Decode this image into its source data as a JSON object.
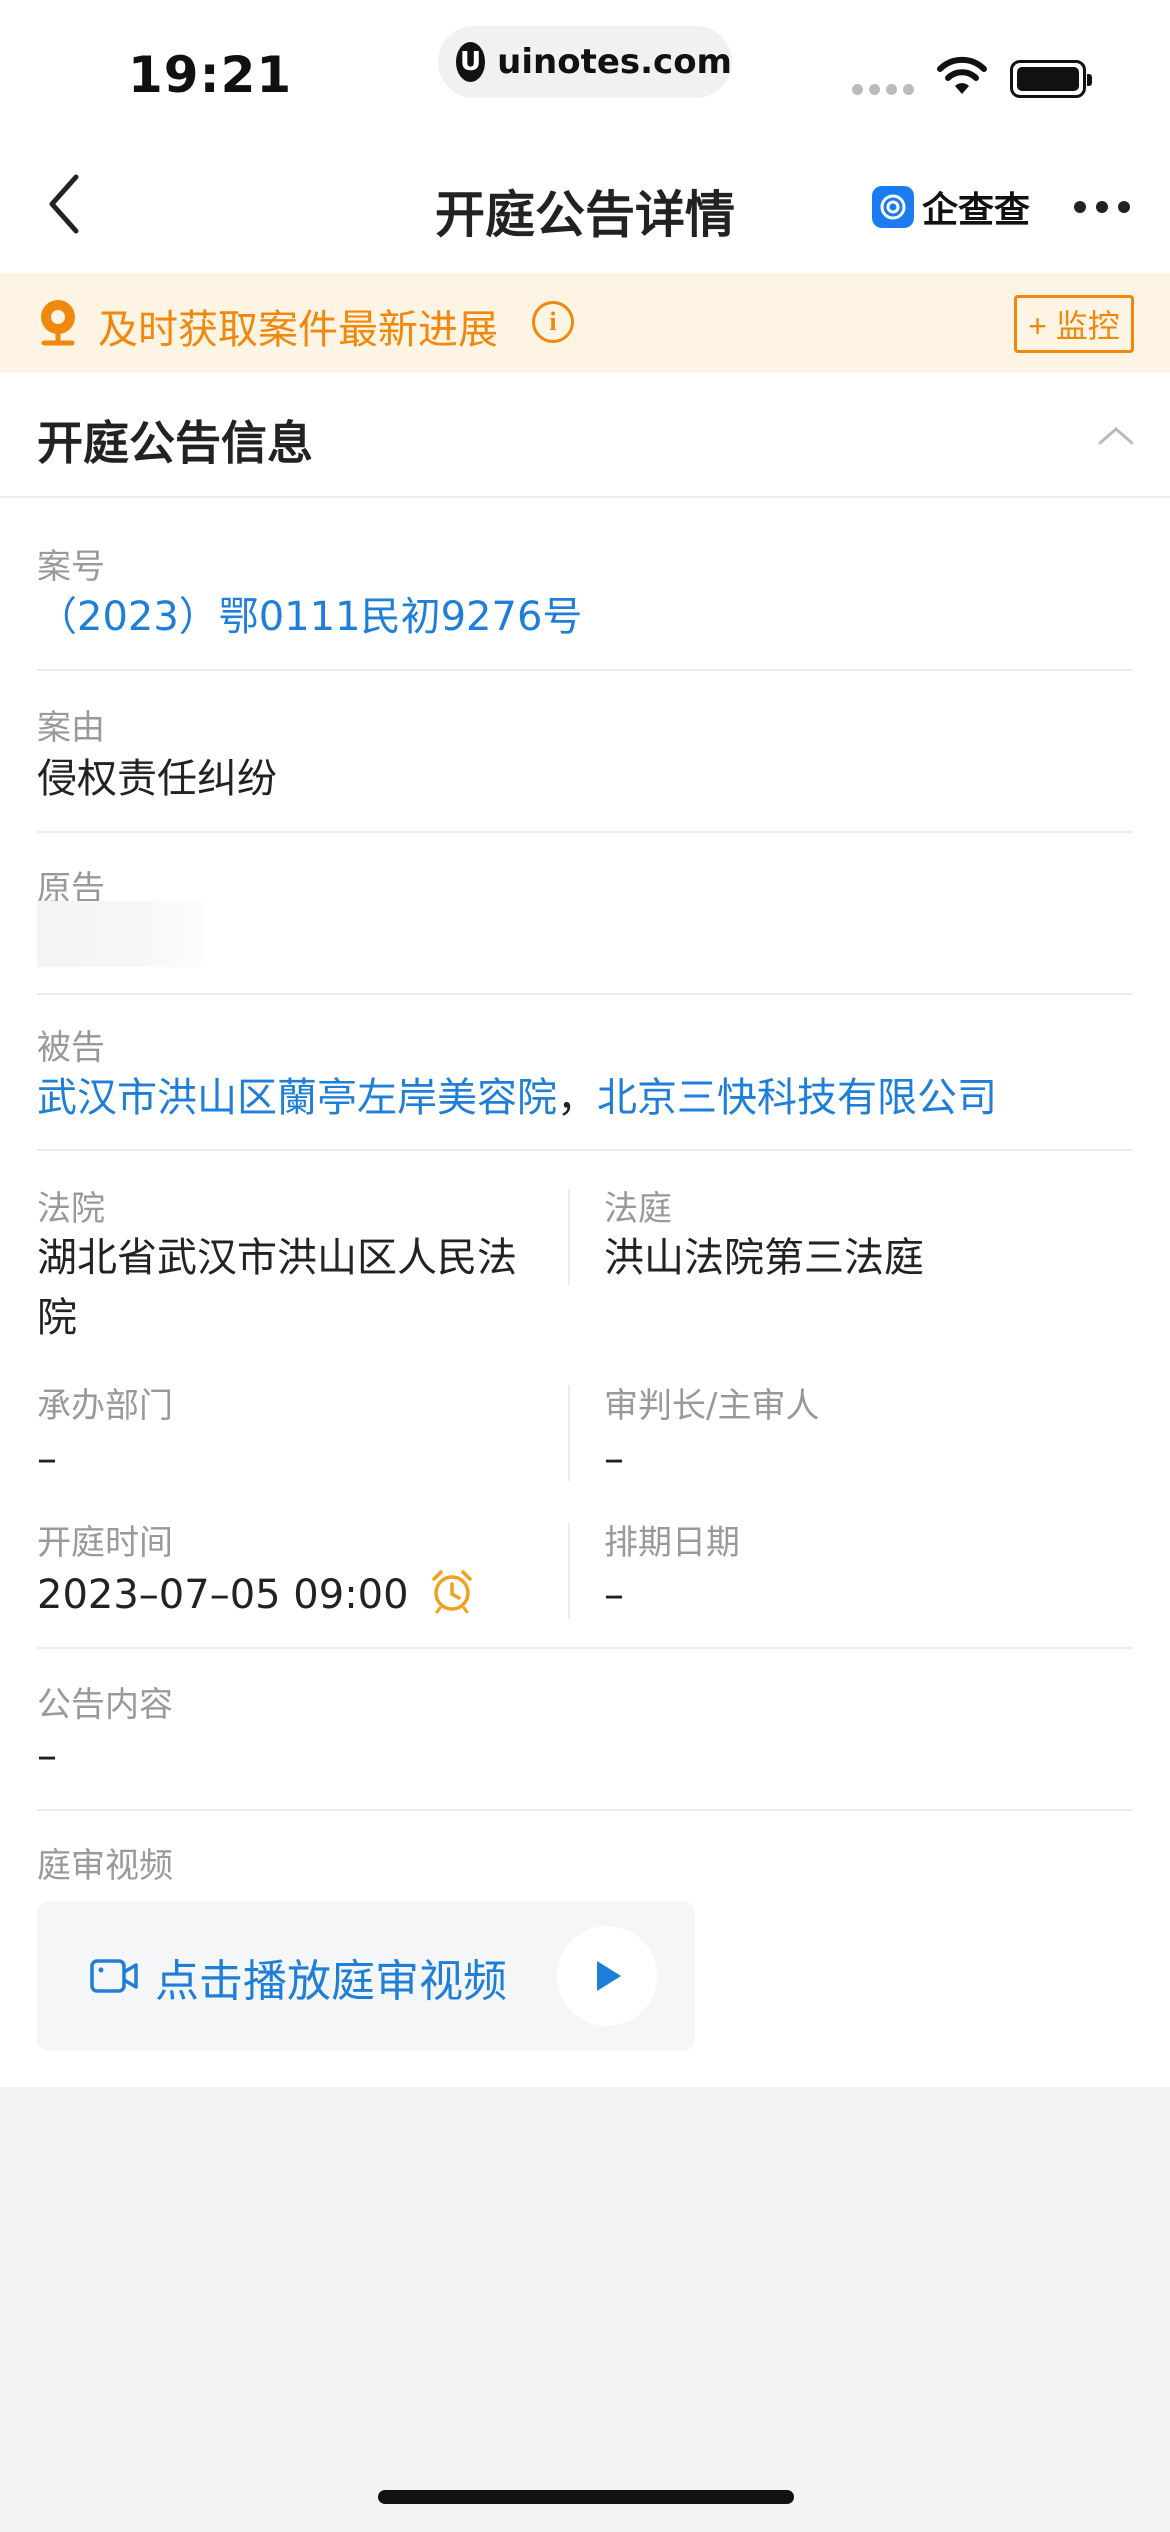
{
  "status_bar": {
    "time": "19:21",
    "url": "uinotes.com",
    "url_logo": "U"
  },
  "nav": {
    "title": "开庭公告详情",
    "brand": "企查查"
  },
  "banner": {
    "text": "及时获取案件最新进展",
    "info_glyph": "i",
    "monitor_label": "+ 监控"
  },
  "section": {
    "title": "开庭公告信息"
  },
  "fields": {
    "case_no": {
      "label": "案号",
      "value": "（2023）鄂0111民初9276号"
    },
    "cause": {
      "label": "案由",
      "value": "侵权责任纠纷"
    },
    "plaintiff": {
      "label": "原告"
    },
    "defendant": {
      "label": "被告",
      "value1": "武汉市洪山区蘭亭左岸美容院",
      "separator": "，",
      "value2": "北京三快科技有限公司"
    },
    "court": {
      "label": "法院",
      "value_line1": "湖北省武汉市洪山区人民法",
      "value_line2": "院"
    },
    "courtroom": {
      "label": "法庭",
      "value": "洪山法院第三法庭"
    },
    "department": {
      "label": "承办部门",
      "value": "–"
    },
    "judge": {
      "label": "审判长/主审人",
      "value": "–"
    },
    "hearing_time": {
      "label": "开庭时间",
      "value": "2023–07–05 09:00"
    },
    "schedule_date": {
      "label": "排期日期",
      "value": "–"
    },
    "content": {
      "label": "公告内容",
      "value": "–"
    },
    "video": {
      "label": "庭审视频",
      "button_text": "点击播放庭审视频"
    }
  },
  "colors": {
    "accent_orange": "#f0880d",
    "link_blue": "#1f7fd8",
    "banner_bg": "#fef4e4"
  },
  "icons": [
    "back-arrow-icon",
    "wifi-icon",
    "battery-icon",
    "more-icon",
    "location-bell-icon",
    "info-icon",
    "chevron-up-icon",
    "alarm-clock-icon",
    "video-camera-icon",
    "play-icon"
  ]
}
